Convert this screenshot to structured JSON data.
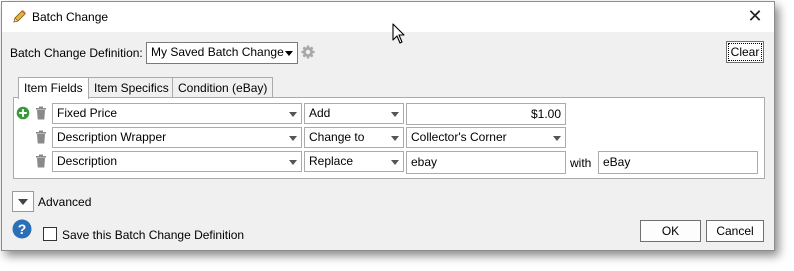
{
  "window": {
    "title": "Batch Change",
    "close_glyph": "✕"
  },
  "definition": {
    "label": "Batch Change Definition:",
    "selected": "My Saved Batch Change",
    "clear_label": "Clear"
  },
  "tabs": [
    {
      "label": "Item Fields",
      "active": true
    },
    {
      "label": "Item Specifics",
      "active": false
    },
    {
      "label": "Condition (eBay)",
      "active": false
    }
  ],
  "rows": [
    {
      "field": "Fixed Price",
      "action": "Add",
      "value": "$1.00",
      "with_label": "",
      "with_value": ""
    },
    {
      "field": "Description Wrapper",
      "action": "Change to",
      "value": "Collector's Corner",
      "with_label": "",
      "with_value": ""
    },
    {
      "field": "Description",
      "action": "Replace",
      "value": "ebay",
      "with_label": "with",
      "with_value": "eBay"
    }
  ],
  "advanced": {
    "label": "Advanced"
  },
  "footer": {
    "save_label": "Save this Batch Change Definition",
    "save_checked": false,
    "ok_label": "OK",
    "cancel_label": "Cancel"
  },
  "colors": {
    "add_icon": "#3a9a3a",
    "help_icon": "#2b6fb6",
    "trash_icon": "#8a8a8a"
  }
}
